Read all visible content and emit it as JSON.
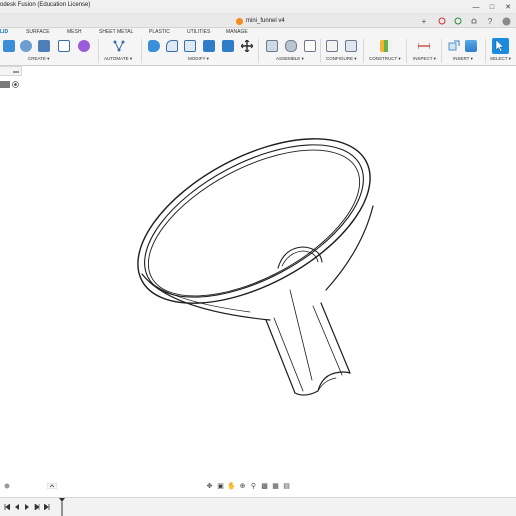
{
  "window": {
    "title": "odesk Fusion (Education License)",
    "controls": [
      "minimize-icon",
      "maximize-icon",
      "close-icon"
    ]
  },
  "tabs": {
    "document_name": "mini_funnel v4"
  },
  "ribbon": {
    "workspace_tabs": [
      "LID",
      "SURFACE",
      "MESH",
      "SHEET METAL",
      "PLASTIC",
      "UTILITIES",
      "MANAGE"
    ],
    "active_tab": "LID",
    "groups": [
      "CREATE ▾",
      "AUTOMATE ▾",
      "MODIFY ▾",
      "ASSEMBLE ▾",
      "CONFIGURE ▾",
      "CONSTRUCT ▾",
      "INSPECT ▾",
      "INSERT ▾",
      "SELECT ▾"
    ],
    "accent_color": "#1b8be0"
  },
  "viewport": {
    "model": "funnel"
  }
}
